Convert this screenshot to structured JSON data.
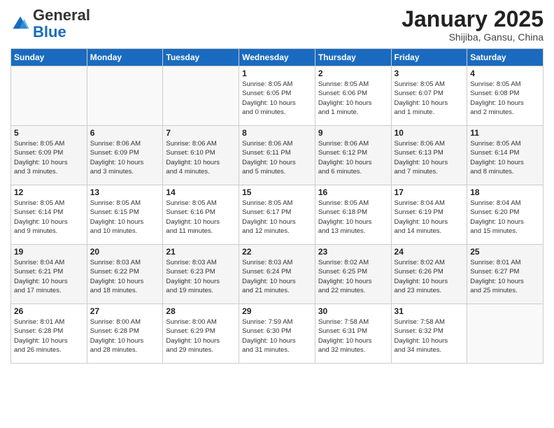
{
  "header": {
    "logo_general": "General",
    "logo_blue": "Blue",
    "month": "January 2025",
    "location": "Shijiba, Gansu, China"
  },
  "weekdays": [
    "Sunday",
    "Monday",
    "Tuesday",
    "Wednesday",
    "Thursday",
    "Friday",
    "Saturday"
  ],
  "weeks": [
    [
      {
        "day": "",
        "info": ""
      },
      {
        "day": "",
        "info": ""
      },
      {
        "day": "",
        "info": ""
      },
      {
        "day": "1",
        "info": "Sunrise: 8:05 AM\nSunset: 6:05 PM\nDaylight: 10 hours\nand 0 minutes."
      },
      {
        "day": "2",
        "info": "Sunrise: 8:05 AM\nSunset: 6:06 PM\nDaylight: 10 hours\nand 1 minute."
      },
      {
        "day": "3",
        "info": "Sunrise: 8:05 AM\nSunset: 6:07 PM\nDaylight: 10 hours\nand 1 minute."
      },
      {
        "day": "4",
        "info": "Sunrise: 8:05 AM\nSunset: 6:08 PM\nDaylight: 10 hours\nand 2 minutes."
      }
    ],
    [
      {
        "day": "5",
        "info": "Sunrise: 8:05 AM\nSunset: 6:09 PM\nDaylight: 10 hours\nand 3 minutes."
      },
      {
        "day": "6",
        "info": "Sunrise: 8:06 AM\nSunset: 6:09 PM\nDaylight: 10 hours\nand 3 minutes."
      },
      {
        "day": "7",
        "info": "Sunrise: 8:06 AM\nSunset: 6:10 PM\nDaylight: 10 hours\nand 4 minutes."
      },
      {
        "day": "8",
        "info": "Sunrise: 8:06 AM\nSunset: 6:11 PM\nDaylight: 10 hours\nand 5 minutes."
      },
      {
        "day": "9",
        "info": "Sunrise: 8:06 AM\nSunset: 6:12 PM\nDaylight: 10 hours\nand 6 minutes."
      },
      {
        "day": "10",
        "info": "Sunrise: 8:06 AM\nSunset: 6:13 PM\nDaylight: 10 hours\nand 7 minutes."
      },
      {
        "day": "11",
        "info": "Sunrise: 8:05 AM\nSunset: 6:14 PM\nDaylight: 10 hours\nand 8 minutes."
      }
    ],
    [
      {
        "day": "12",
        "info": "Sunrise: 8:05 AM\nSunset: 6:14 PM\nDaylight: 10 hours\nand 9 minutes."
      },
      {
        "day": "13",
        "info": "Sunrise: 8:05 AM\nSunset: 6:15 PM\nDaylight: 10 hours\nand 10 minutes."
      },
      {
        "day": "14",
        "info": "Sunrise: 8:05 AM\nSunset: 6:16 PM\nDaylight: 10 hours\nand 11 minutes."
      },
      {
        "day": "15",
        "info": "Sunrise: 8:05 AM\nSunset: 6:17 PM\nDaylight: 10 hours\nand 12 minutes."
      },
      {
        "day": "16",
        "info": "Sunrise: 8:05 AM\nSunset: 6:18 PM\nDaylight: 10 hours\nand 13 minutes."
      },
      {
        "day": "17",
        "info": "Sunrise: 8:04 AM\nSunset: 6:19 PM\nDaylight: 10 hours\nand 14 minutes."
      },
      {
        "day": "18",
        "info": "Sunrise: 8:04 AM\nSunset: 6:20 PM\nDaylight: 10 hours\nand 15 minutes."
      }
    ],
    [
      {
        "day": "19",
        "info": "Sunrise: 8:04 AM\nSunset: 6:21 PM\nDaylight: 10 hours\nand 17 minutes."
      },
      {
        "day": "20",
        "info": "Sunrise: 8:03 AM\nSunset: 6:22 PM\nDaylight: 10 hours\nand 18 minutes."
      },
      {
        "day": "21",
        "info": "Sunrise: 8:03 AM\nSunset: 6:23 PM\nDaylight: 10 hours\nand 19 minutes."
      },
      {
        "day": "22",
        "info": "Sunrise: 8:03 AM\nSunset: 6:24 PM\nDaylight: 10 hours\nand 21 minutes."
      },
      {
        "day": "23",
        "info": "Sunrise: 8:02 AM\nSunset: 6:25 PM\nDaylight: 10 hours\nand 22 minutes."
      },
      {
        "day": "24",
        "info": "Sunrise: 8:02 AM\nSunset: 6:26 PM\nDaylight: 10 hours\nand 23 minutes."
      },
      {
        "day": "25",
        "info": "Sunrise: 8:01 AM\nSunset: 6:27 PM\nDaylight: 10 hours\nand 25 minutes."
      }
    ],
    [
      {
        "day": "26",
        "info": "Sunrise: 8:01 AM\nSunset: 6:28 PM\nDaylight: 10 hours\nand 26 minutes."
      },
      {
        "day": "27",
        "info": "Sunrise: 8:00 AM\nSunset: 6:28 PM\nDaylight: 10 hours\nand 28 minutes."
      },
      {
        "day": "28",
        "info": "Sunrise: 8:00 AM\nSunset: 6:29 PM\nDaylight: 10 hours\nand 29 minutes."
      },
      {
        "day": "29",
        "info": "Sunrise: 7:59 AM\nSunset: 6:30 PM\nDaylight: 10 hours\nand 31 minutes."
      },
      {
        "day": "30",
        "info": "Sunrise: 7:58 AM\nSunset: 6:31 PM\nDaylight: 10 hours\nand 32 minutes."
      },
      {
        "day": "31",
        "info": "Sunrise: 7:58 AM\nSunset: 6:32 PM\nDaylight: 10 hours\nand 34 minutes."
      },
      {
        "day": "",
        "info": ""
      }
    ]
  ]
}
